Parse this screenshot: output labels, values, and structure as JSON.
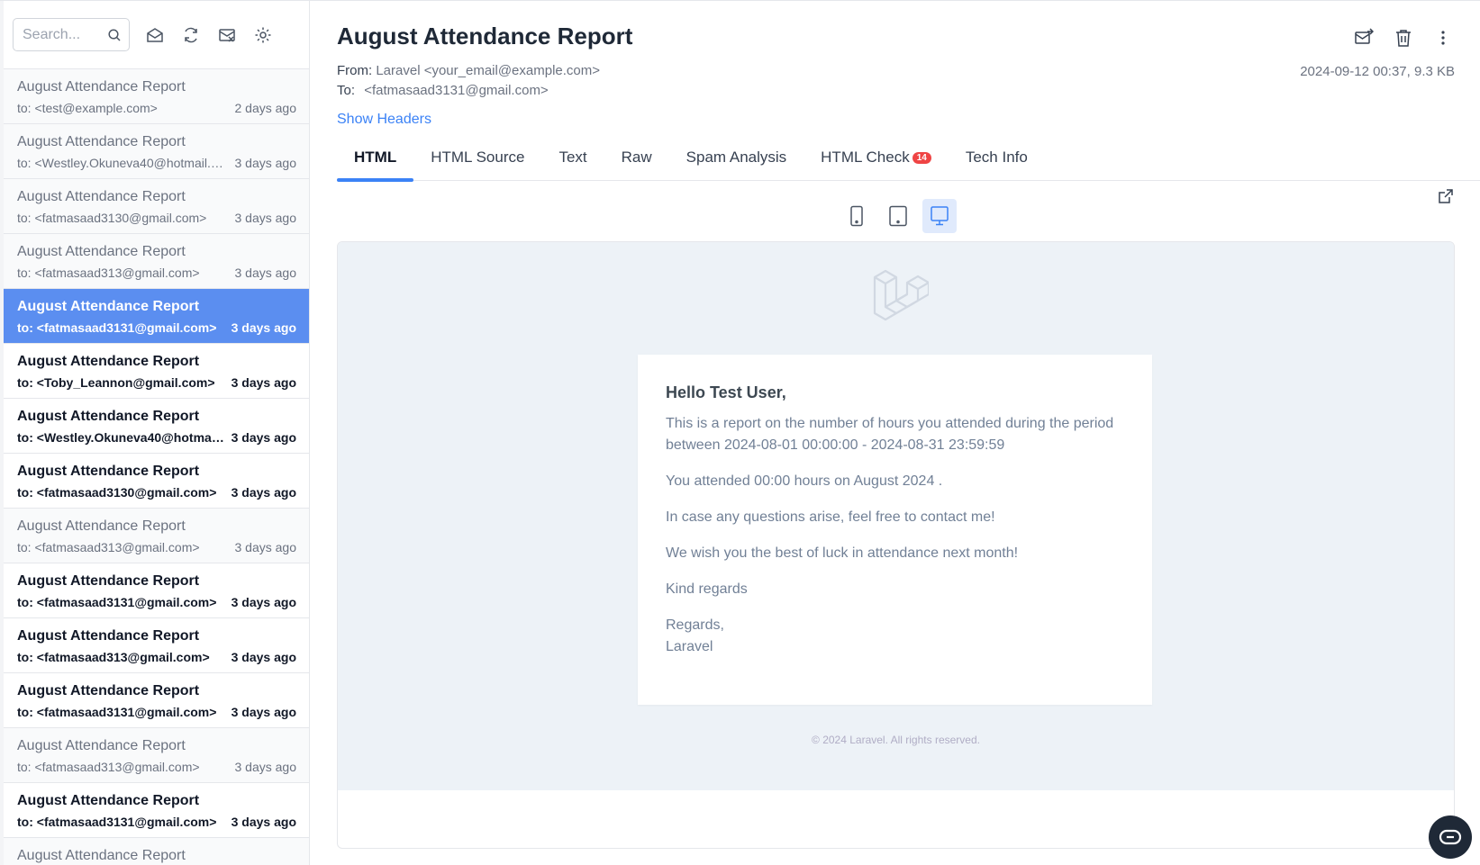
{
  "toolbar": {
    "search_placeholder": "Search...",
    "icons": [
      "search-icon",
      "mark-read-icon",
      "refresh-icon",
      "clear-inbox-icon",
      "gear-icon"
    ]
  },
  "messages": [
    {
      "subject": "August Attendance Report",
      "to": "to: <test@example.com>",
      "ago": "2 days ago",
      "state": "read"
    },
    {
      "subject": "August Attendance Report",
      "to": "to: <Westley.Okuneva40@hotmail.co...",
      "ago": "3 days ago",
      "state": "read"
    },
    {
      "subject": "August Attendance Report",
      "to": "to: <fatmasaad3130@gmail.com>",
      "ago": "3 days ago",
      "state": "read"
    },
    {
      "subject": "August Attendance Report",
      "to": "to: <fatmasaad313@gmail.com>",
      "ago": "3 days ago",
      "state": "read"
    },
    {
      "subject": "August Attendance Report",
      "to": "to: <fatmasaad3131@gmail.com>",
      "ago": "3 days ago",
      "state": "active"
    },
    {
      "subject": "August Attendance Report",
      "to": "to: <Toby_Leannon@gmail.com>",
      "ago": "3 days ago",
      "state": "unread"
    },
    {
      "subject": "August Attendance Report",
      "to": "to: <Westley.Okuneva40@hotmail....",
      "ago": "3 days ago",
      "state": "unread"
    },
    {
      "subject": "August Attendance Report",
      "to": "to: <fatmasaad3130@gmail.com>",
      "ago": "3 days ago",
      "state": "unread"
    },
    {
      "subject": "August Attendance Report",
      "to": "to: <fatmasaad313@gmail.com>",
      "ago": "3 days ago",
      "state": "read"
    },
    {
      "subject": "August Attendance Report",
      "to": "to: <fatmasaad3131@gmail.com>",
      "ago": "3 days ago",
      "state": "unread"
    },
    {
      "subject": "August Attendance Report",
      "to": "to: <fatmasaad313@gmail.com>",
      "ago": "3 days ago",
      "state": "unread"
    },
    {
      "subject": "August Attendance Report",
      "to": "to: <fatmasaad3131@gmail.com>",
      "ago": "3 days ago",
      "state": "unread"
    },
    {
      "subject": "August Attendance Report",
      "to": "to: <fatmasaad313@gmail.com>",
      "ago": "3 days ago",
      "state": "read"
    },
    {
      "subject": "August Attendance Report",
      "to": "to: <fatmasaad3131@gmail.com>",
      "ago": "3 days ago",
      "state": "unread"
    },
    {
      "subject": "August Attendance Report",
      "to": "",
      "ago": "",
      "state": "read"
    }
  ],
  "email": {
    "title": "August Attendance Report",
    "from_label": "From:",
    "from_value": "Laravel <your_email@example.com>",
    "to_label": "To:",
    "to_value": "<fatmasaad3131@gmail.com>",
    "meta": "2024-09-12 00:37, 9.3 KB",
    "show_headers": "Show Headers"
  },
  "tabs": [
    {
      "label": "HTML",
      "active": true
    },
    {
      "label": "HTML Source",
      "active": false
    },
    {
      "label": "Text",
      "active": false
    },
    {
      "label": "Raw",
      "active": false
    },
    {
      "label": "Spam Analysis",
      "active": false
    },
    {
      "label": "HTML Check",
      "active": false,
      "badge": "14"
    },
    {
      "label": "Tech Info",
      "active": false
    }
  ],
  "devices": [
    "phone-icon",
    "tablet-icon",
    "desktop-icon"
  ],
  "active_device": "desktop-icon",
  "body": {
    "greeting": "Hello Test User,",
    "p1": "This is a report on the number of hours you attended during the period between 2024-08-01 00:00:00 - 2024-08-31 23:59:59",
    "p2": "You attended 00:00 hours on August 2024 .",
    "p3": "In case any questions arise, feel free to contact me!",
    "p4": "We wish you the best of luck in attendance next month!",
    "p5": "Kind regards",
    "p6a": "Regards,",
    "p6b": "Laravel",
    "footer": "© 2024 Laravel. All rights reserved."
  },
  "colors": {
    "accent": "#3b82f6",
    "active_item": "#5b8ef0",
    "badge": "#ef4444",
    "preview_bg": "#edf2f7"
  }
}
